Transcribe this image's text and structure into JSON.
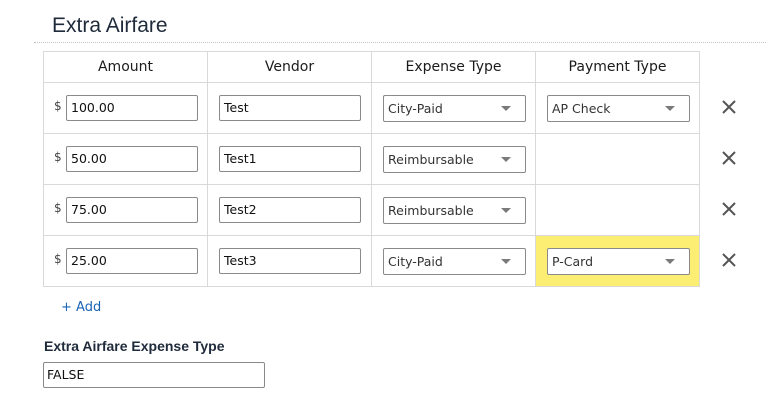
{
  "section": {
    "title": "Extra Airfare"
  },
  "table": {
    "headers": [
      "Amount",
      "Vendor",
      "Expense Type",
      "Payment Type"
    ],
    "currency_symbol": "$",
    "rows": [
      {
        "amount": "100.00",
        "vendor": "Test",
        "expense_type": "City-Paid",
        "payment_type": "AP Check",
        "highlighted": false
      },
      {
        "amount": "50.00",
        "vendor": "Test1",
        "expense_type": "Reimbursable",
        "payment_type": null,
        "highlighted": false
      },
      {
        "amount": "75.00",
        "vendor": "Test2",
        "expense_type": "Reimbursable",
        "payment_type": null,
        "highlighted": false
      },
      {
        "amount": "25.00",
        "vendor": "Test3",
        "expense_type": "City-Paid",
        "payment_type": "P-Card",
        "highlighted": true
      }
    ],
    "remove_icon": "close-icon"
  },
  "add_link": {
    "label": "+ Add"
  },
  "expense_type_field": {
    "label": "Extra Airfare Expense Type",
    "value": "FALSE"
  },
  "colors": {
    "highlight": "#fbee72",
    "link": "#1a64b8",
    "border": "#d9d9d9"
  }
}
